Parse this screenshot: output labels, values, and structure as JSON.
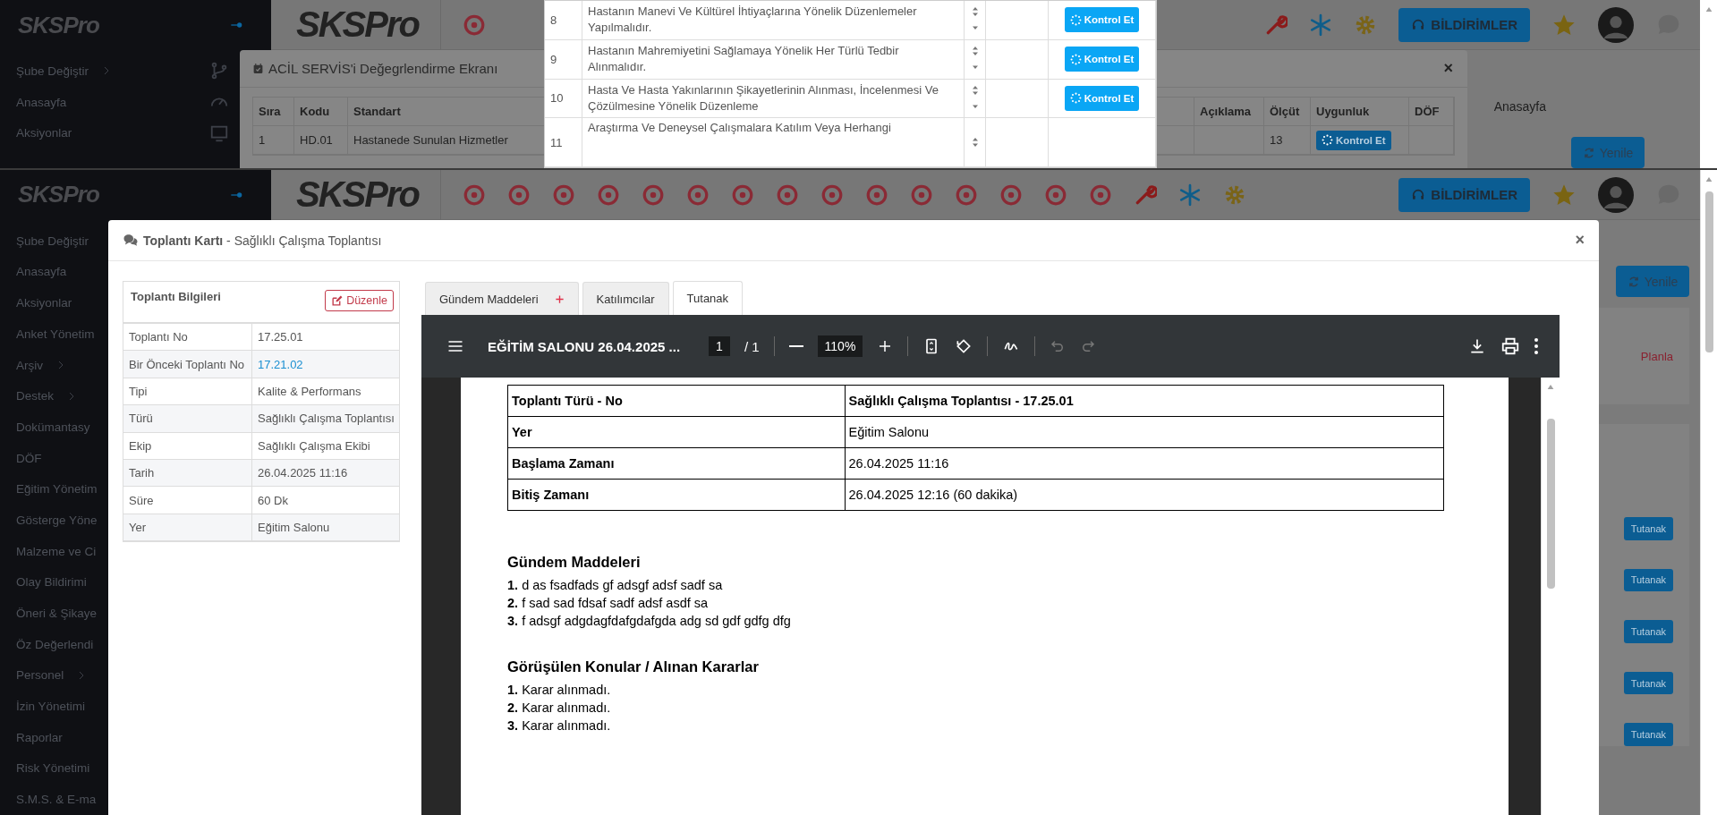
{
  "top_screen": {
    "sidebar": {
      "logo": "SKSPro",
      "items": [
        {
          "label": "Şube Değiştir",
          "expandable": true
        },
        {
          "label": "Anasayfa",
          "expandable": false
        },
        {
          "label": "Aksiyonlar",
          "expandable": false
        }
      ]
    },
    "header": {
      "logo": "SKSPro",
      "notifications_button": "BİLDİRİMLER"
    },
    "breadcrumb": "Anasayfa",
    "refresh_button": "Yenile",
    "evaluation_modal": {
      "title": "ACİL SERVİS'i Değegrlendirme Ekranı",
      "close_button": "×",
      "columns": [
        "Sıra",
        "Kodu",
        "Standart",
        "Açıklama",
        "Ölçüt",
        "Uygunluk",
        "DÖF"
      ],
      "rows": [
        {
          "no": "1",
          "code": "HD.01",
          "standard": "Hastanede Sunulan Hizmetler",
          "criterion": "13",
          "action": "Kontrol Et"
        }
      ]
    },
    "standards_popup": {
      "rows": [
        {
          "no": "8",
          "text": "Hastanın Manevi Ve Kültürel İhtiyaçlarına Yönelik Düzenlemeler Yapılmalıdır.",
          "action": "Kontrol Et"
        },
        {
          "no": "9",
          "text": "Hastanın Mahremiyetini Sağlamaya Yönelik Her Türlü Tedbir Alınmalıdır.",
          "action": "Kontrol Et"
        },
        {
          "no": "10",
          "text": "Hasta Ve Hasta Yakınlarının Şikayetlerinin Alınması, İncelenmesi Ve Çözülmesine Yönelik Düzenleme",
          "action": "Kontrol Et"
        },
        {
          "no": "11",
          "text": "Araştırma Ve Deneysel Çalışmalara Katılım Veya Herhangi"
        }
      ]
    }
  },
  "main_screen": {
    "sidebar": {
      "logo": "SKSPro",
      "items": [
        {
          "label": "Şube Değiştir"
        },
        {
          "label": "Anasayfa"
        },
        {
          "label": "Aksiyonlar"
        },
        {
          "label": "Anket Yönetim"
        },
        {
          "label": "Arşiv",
          "expandable": true
        },
        {
          "label": "Destek",
          "expandable": true
        },
        {
          "label": "Dokümantasy"
        },
        {
          "label": "DÖF",
          "expandable": false
        },
        {
          "label": "Eğitim Yönetim"
        },
        {
          "label": "Gösterge Yöne"
        },
        {
          "label": "Malzeme ve Ci"
        },
        {
          "label": "Olay Bildirimi"
        },
        {
          "label": "Öneri & Şikaye"
        },
        {
          "label": "Öz Değerlendi"
        },
        {
          "label": "Personel",
          "expandable": true
        },
        {
          "label": "İzin Yönetimi"
        },
        {
          "label": "Raporlar",
          "expandable": false
        },
        {
          "label": "Risk Yönetimi"
        },
        {
          "label": "S.M.S. & E-ma"
        }
      ]
    },
    "header": {
      "logo": "SKSPro",
      "notifications_button": "BİLDİRİMLER"
    },
    "refresh_button": "Yenile",
    "plan_link": "Planla",
    "minutes_buttons": [
      "Tutanak",
      "Tutanak",
      "Tutanak",
      "Tutanak",
      "Tutanak"
    ],
    "modal": {
      "title": "**Toplantı Kartı** - Sağlıklı Çalışma Toplantısı",
      "close_button": "×",
      "info_panel": {
        "title": "Toplantı Bilgileri",
        "edit_button": "Düzenle",
        "rows": [
          {
            "label": "Toplantı No",
            "value": "17.25.01",
            "kind": "text"
          },
          {
            "label": "Bir Önceki Toplantı No",
            "value": "17.21.02",
            "kind": "link"
          },
          {
            "label": "Tipi",
            "value": "Kalite & Performans",
            "kind": "text"
          },
          {
            "label": "Türü",
            "value": "Sağlıklı Çalışma Toplantısı",
            "kind": "text"
          },
          {
            "label": "Ekip",
            "value": "Sağlıklı Çalışma Ekibi",
            "kind": "text"
          },
          {
            "label": "Tarih",
            "value": "26.04.2025 11:16",
            "kind": "text"
          },
          {
            "label": "Süre",
            "value": "60 Dk",
            "kind": "text"
          },
          {
            "label": "Yer",
            "value": "Eğitim Salonu",
            "kind": "text"
          }
        ]
      },
      "tabs": [
        {
          "label": "Gündem Maddeleri",
          "selected": false,
          "addable": true
        },
        {
          "label": "Katılımcılar",
          "selected": false,
          "addable": false
        },
        {
          "label": "Tutanak",
          "selected": true,
          "addable": false
        }
      ],
      "pdf_viewer": {
        "title": "EĞİTİM SALONU 26.04.2025 ...",
        "page": "1",
        "page_total": "/  1",
        "zoom": "110%",
        "document": {
          "summary_rows": [
            {
              "label": "Toplantı Türü - No",
              "value": "Sağlıklı Çalışma Toplantısı - 17.25.01",
              "bold_value": true
            },
            {
              "label": "Yer",
              "value": "Eğitim Salonu",
              "bold_value": false
            },
            {
              "label": "Başlama Zamanı",
              "value": "26.04.2025 11:16",
              "bold_value": false
            },
            {
              "label": "Bitiş Zamanı",
              "value": "26.04.2025 12:16 (60 dakika)",
              "bold_value": false
            }
          ],
          "sections": [
            {
              "heading": "Gündem Maddeleri",
              "items": [
                {
                  "number": "1.",
                  "text": "d as fsadfads gf adsgf adsf sadf sa"
                },
                {
                  "number": "2.",
                  "text": "f sad sad fdsaf sadf adsf asdf sa"
                },
                {
                  "number": "3.",
                  "text": "f adsgf adgdagfdafgdafgda adg sd gdf gdfg dfg"
                }
              ]
            },
            {
              "heading": "Görüşülen Konular / Alınan Kararlar",
              "items": [
                {
                  "number": "1.",
                  "text": "Karar alınmadı."
                },
                {
                  "number": "2.",
                  "text": "Karar alınmadı."
                },
                {
                  "number": "3.",
                  "text": "Karar alınmadı."
                }
              ]
            }
          ]
        }
      }
    }
  }
}
